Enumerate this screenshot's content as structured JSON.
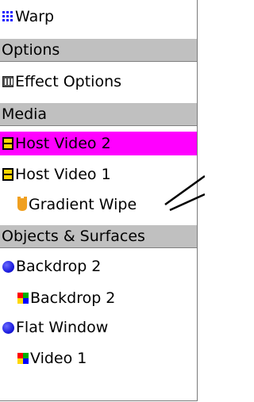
{
  "items": {
    "warp": "Warp",
    "options_header": "Options",
    "effect_options": "Effect Options",
    "media_header": "Media",
    "host_video_2": "Host Video 2",
    "host_video_1": "Host Video 1",
    "gradient_wipe": "Gradient Wipe",
    "objects_header": "Objects & Surfaces",
    "backdrop_2_object": "Backdrop 2",
    "backdrop_2_surface": "Backdrop 2",
    "flat_window": "Flat Window",
    "video_1": "Video 1"
  },
  "colors": {
    "selected_background": "#ff00ff",
    "section_background": "#c0c0c0"
  }
}
